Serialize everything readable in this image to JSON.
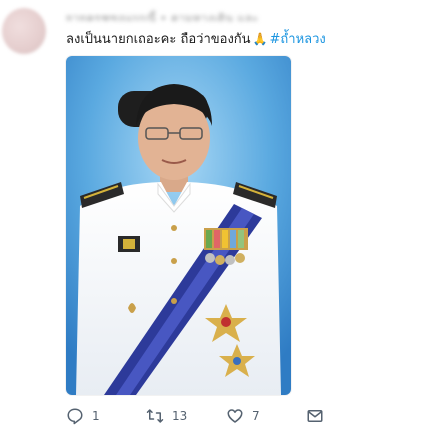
{
  "tweet": {
    "handle": "ยายครุฑขอแบบนี้ • ตามทางเดิน และ",
    "text": "ลงเป็นนายกเถอะคะ ถือว่าของกัน",
    "hashtag": "#ถ้ำหลวง",
    "reply_count": "1",
    "retweet_count": "13",
    "like_count": "7"
  },
  "icons": {
    "inline_emoji": "folded-hands-icon",
    "reply": "reply-icon",
    "retweet": "retweet-icon",
    "like": "heart-icon",
    "message": "envelope-icon"
  },
  "colors": {
    "hashtag": "#1b95e0",
    "action_gray": "#556270",
    "photo_background": "#5aa9e0",
    "sash": "#2d3a9a"
  }
}
